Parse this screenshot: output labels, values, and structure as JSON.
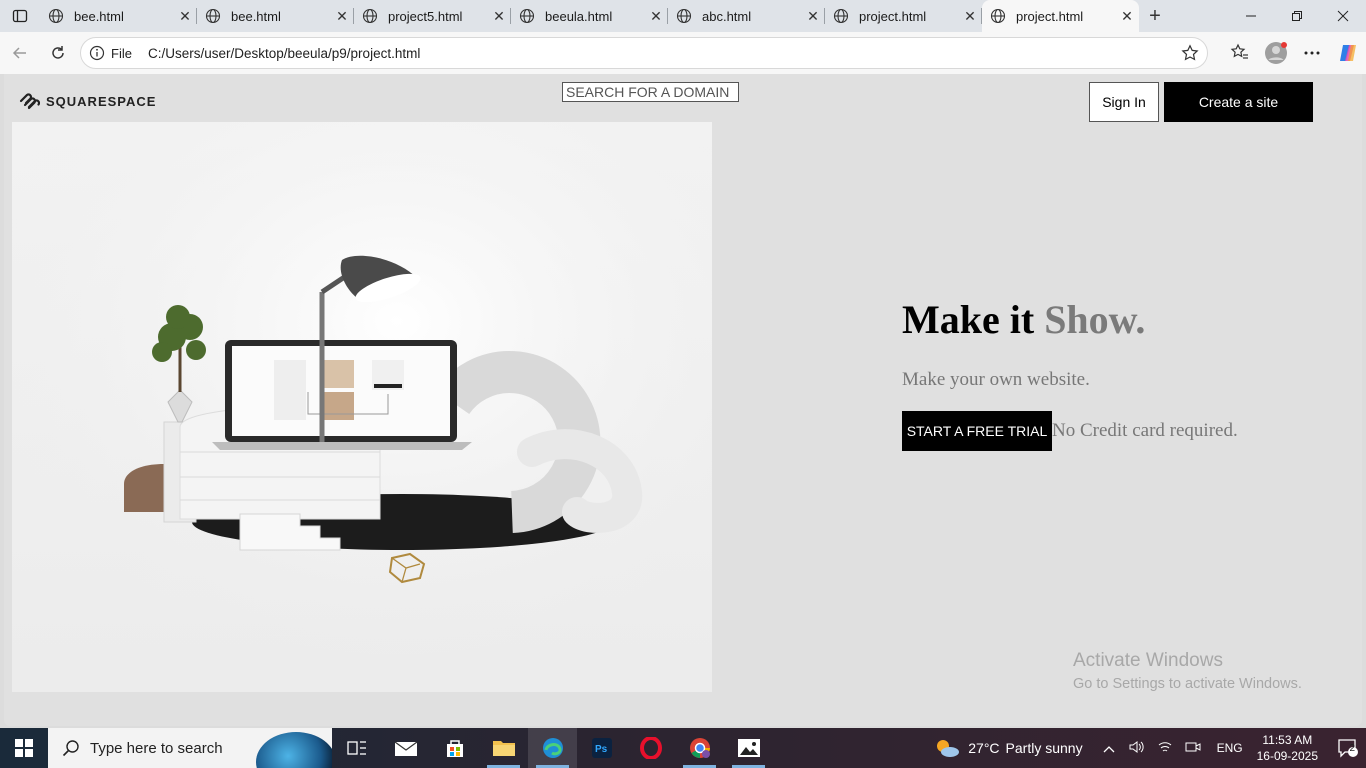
{
  "browser": {
    "tabs": [
      {
        "title": "bee.html",
        "active": false
      },
      {
        "title": "bee.html",
        "active": false
      },
      {
        "title": "project5.html",
        "active": false
      },
      {
        "title": "beeula.html",
        "active": false
      },
      {
        "title": "abc.html",
        "active": false
      },
      {
        "title": "project.html",
        "active": false
      },
      {
        "title": "project.html",
        "active": true
      }
    ],
    "address": {
      "scheme_label": "File",
      "url": "C:/Users/user/Desktop/beeula/p9/project.html"
    }
  },
  "page": {
    "logo_text": "SQUARESPACE",
    "search_placeholder": "SEARCH FOR A DOMAIN",
    "signin_label": "Sign In",
    "create_label": "Create a site",
    "headline_main": "Make it ",
    "headline_accent": "Show.",
    "subheadline": "Make your own website.",
    "cta_label": "START A FREE TRIAL",
    "cta_note": "No Credit card required."
  },
  "watermark": {
    "line1": "Activate Windows",
    "line2": "Go to Settings to activate Windows."
  },
  "taskbar": {
    "search_placeholder": "Type here to search",
    "weather_temp": "27°C",
    "weather_desc": "Partly sunny",
    "language": "ENG",
    "time": "11:53 AM",
    "date": "16-09-2025",
    "notification_count": "2"
  }
}
